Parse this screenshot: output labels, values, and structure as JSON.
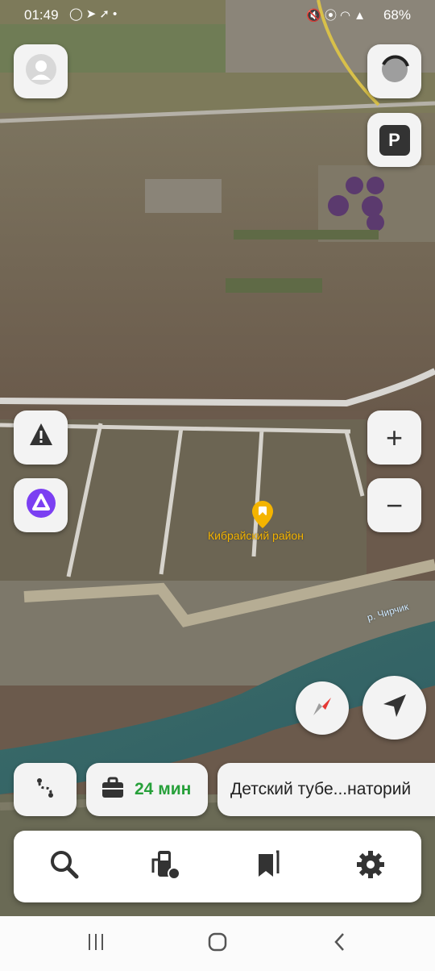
{
  "status_bar": {
    "time": "01:49",
    "left_icons": [
      "whatsapp-icon",
      "telegram-icon",
      "location-arrow-icon",
      "dot-icon"
    ],
    "right_icons": [
      "mute-icon",
      "location-icon",
      "wifi-icon",
      "signal-icon"
    ],
    "battery": "68%"
  },
  "map": {
    "district_label": "Кибрайский район",
    "river_label": "р. Чирчик"
  },
  "controls": {
    "profile": "avatar-icon",
    "layers": "layers-icon",
    "parking_label": "P",
    "alert": "alert-icon",
    "alice": "alice-icon",
    "zoom_in": "+",
    "zoom_out": "−",
    "compass": "compass-icon",
    "my_location": "navigation-arrow-icon"
  },
  "route_bar": {
    "route_icon": "route-icon",
    "travel_icon": "briefcase-icon",
    "travel_time": "24 мин",
    "destination": "Детский тубе...наторий"
  },
  "bottom_tabs": [
    {
      "icon": "search-icon"
    },
    {
      "icon": "gas-station-icon"
    },
    {
      "icon": "bookmarks-icon"
    },
    {
      "icon": "settings-icon"
    }
  ],
  "system_nav": [
    "recents-icon",
    "home-icon",
    "back-icon"
  ],
  "colors": {
    "accent_green": "#27a03a",
    "alice_purple": "#7b3ff2",
    "label_yellow": "#f4b400",
    "road_white": "#e6e6e6"
  }
}
